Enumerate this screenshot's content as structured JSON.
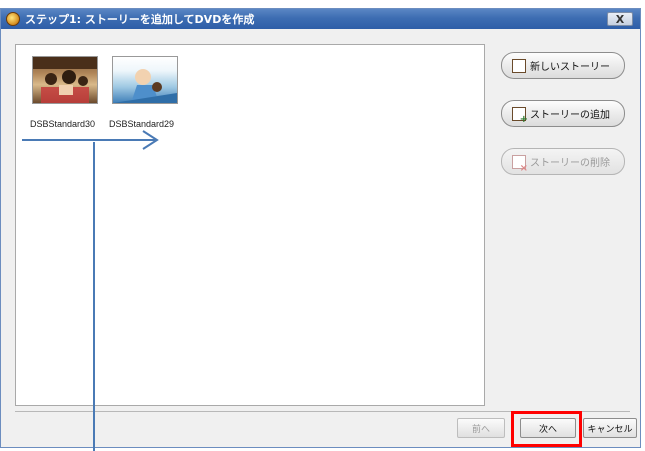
{
  "window": {
    "title": "ステップ1: ストーリーを追加してDVDを作成",
    "close_label": "X"
  },
  "stories": [
    {
      "label": "DSBStandard30"
    },
    {
      "label": "DSBStandard29"
    }
  ],
  "side_buttons": {
    "new_story": "新しいストーリー",
    "add_story": "ストーリーの追加",
    "delete_story": "ストーリーの削除"
  },
  "bottom_buttons": {
    "prev": "前へ",
    "next": "次へ",
    "cancel": "キャンセル"
  },
  "colors": {
    "titlebar": "#3d6db2",
    "highlight": "#ff0000",
    "annotation_arrow": "#4a7ab5"
  }
}
